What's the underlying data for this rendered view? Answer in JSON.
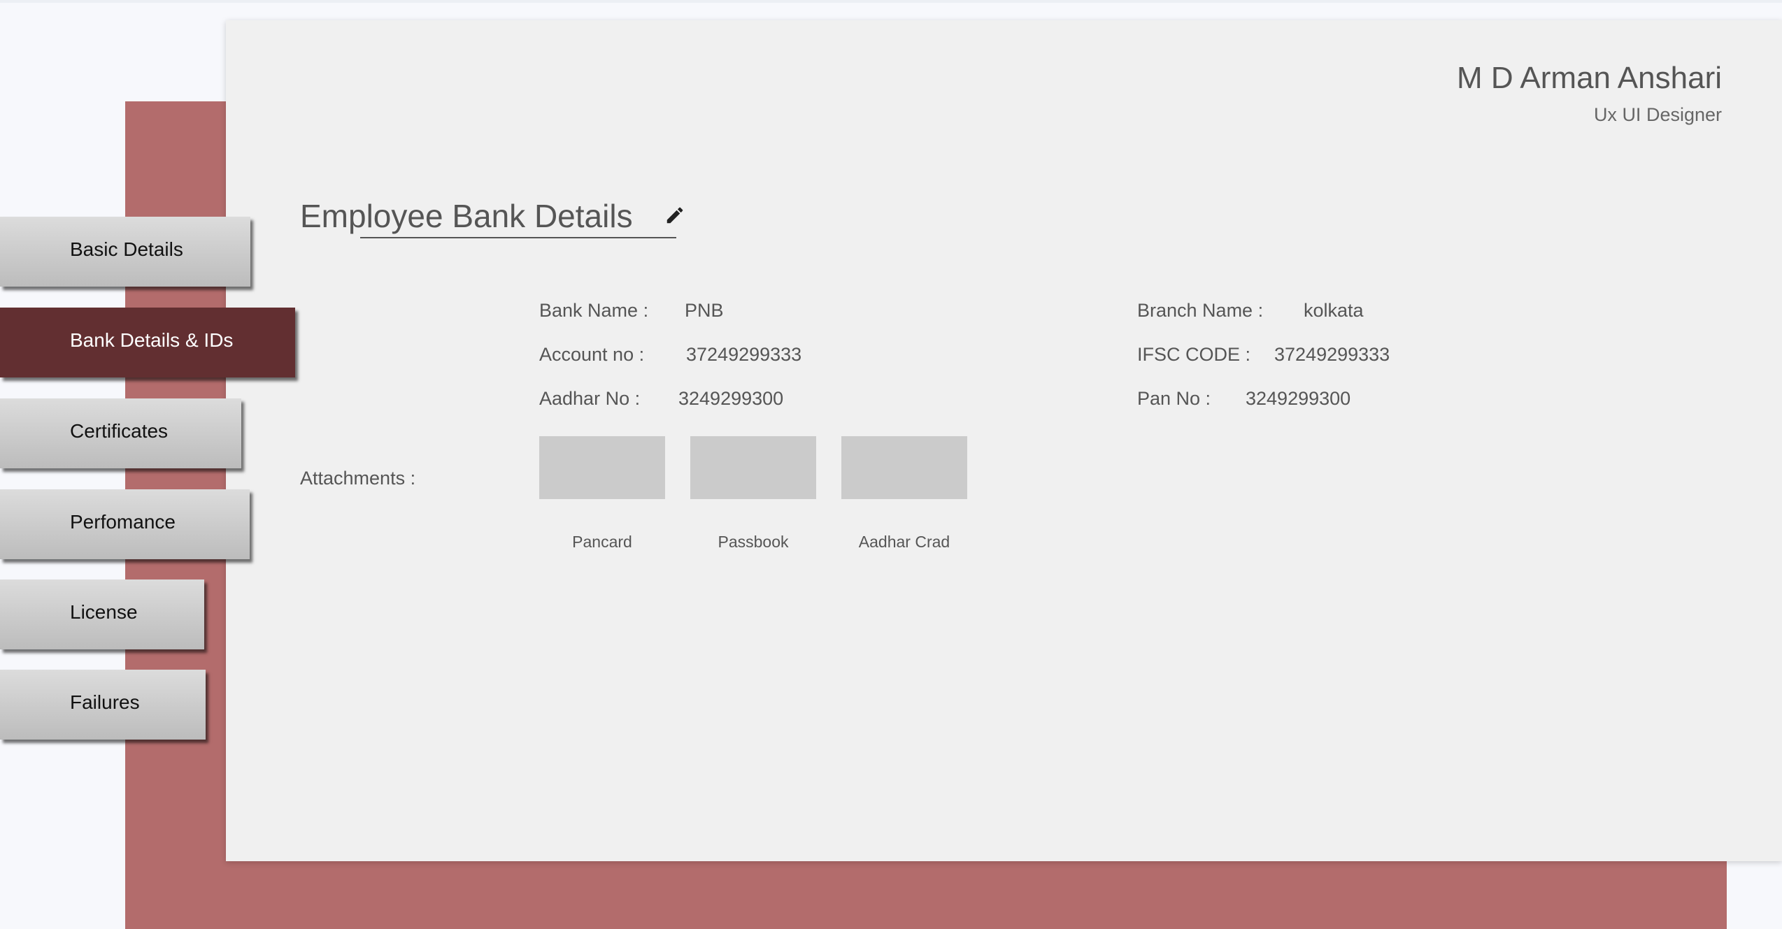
{
  "header": {
    "user_name": "M D Arman Anshari",
    "user_role": "Ux UI Designer"
  },
  "section": {
    "title": "Employee Bank Details",
    "edit_icon": "pencil-icon"
  },
  "sidebar": {
    "items": [
      {
        "label": "Basic Details",
        "active": false
      },
      {
        "label": "Bank Details & IDs",
        "active": true
      },
      {
        "label": "Certificates",
        "active": false
      },
      {
        "label": "Perfomance",
        "active": false
      },
      {
        "label": "License",
        "active": false
      },
      {
        "label": "Failures",
        "active": false
      }
    ]
  },
  "fields": {
    "bank_name": {
      "label": "Bank Name :",
      "value": "PNB"
    },
    "account_no": {
      "label": "Account no :",
      "value": "37249299333"
    },
    "aadhar_no": {
      "label": "Aadhar No :",
      "value": "3249299300"
    },
    "branch_name": {
      "label": "Branch Name :",
      "value": "kolkata"
    },
    "ifsc_code": {
      "label": "IFSC CODE :",
      "value": "37249299333"
    },
    "pan_no": {
      "label": "Pan No :",
      "value": "3249299300"
    }
  },
  "attachments": {
    "label": "Attachments :",
    "items": [
      {
        "caption": "Pancard"
      },
      {
        "caption": "Passbook"
      },
      {
        "caption": "Aadhar Crad"
      }
    ]
  },
  "colors": {
    "accent_panel": "#b36c6c",
    "active_nav": "#622f31",
    "card_bg": "#f0f0f0"
  }
}
